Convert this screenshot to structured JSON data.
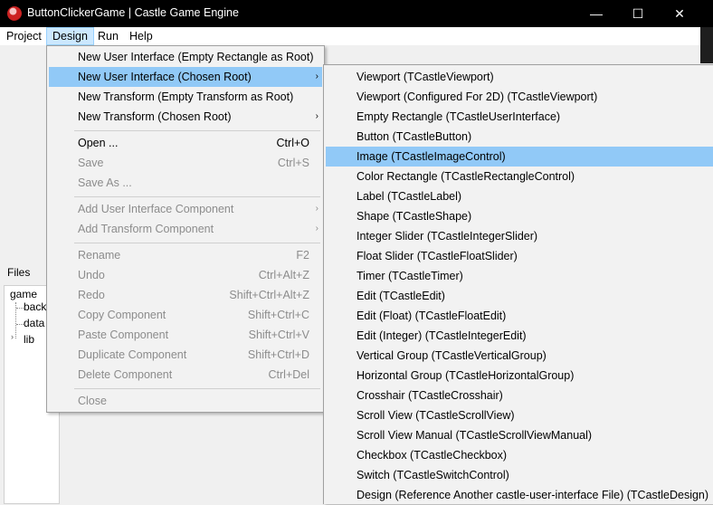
{
  "window": {
    "title": "ButtonClickerGame | Castle Game Engine",
    "minimize": "—",
    "maximize": "☐",
    "close": "✕"
  },
  "menubar": {
    "items": [
      "Project",
      "Design",
      "Run",
      "Help"
    ]
  },
  "files": {
    "tab": "Files",
    "tree": [
      "game",
      "back",
      "data",
      "lib"
    ]
  },
  "design_menu": {
    "items": [
      {
        "label": "New User Interface (Empty Rectangle as Root)",
        "shortcut": "",
        "submenu": ""
      },
      {
        "label": "New User Interface (Chosen Root)",
        "shortcut": "",
        "submenu": "›"
      },
      {
        "label": "New Transform (Empty Transform as Root)",
        "shortcut": "",
        "submenu": ""
      },
      {
        "label": "New Transform (Chosen Root)",
        "shortcut": "",
        "submenu": "›"
      },
      {
        "label": "Open ...",
        "shortcut": "Ctrl+O",
        "submenu": ""
      },
      {
        "label": "Save",
        "shortcut": "Ctrl+S",
        "submenu": ""
      },
      {
        "label": "Save As ...",
        "shortcut": "",
        "submenu": ""
      },
      {
        "label": "Add User Interface Component",
        "shortcut": "",
        "submenu": "›"
      },
      {
        "label": "Add Transform Component",
        "shortcut": "",
        "submenu": "›"
      },
      {
        "label": "Rename",
        "shortcut": "F2",
        "submenu": ""
      },
      {
        "label": "Undo",
        "shortcut": "Ctrl+Alt+Z",
        "submenu": ""
      },
      {
        "label": "Redo",
        "shortcut": "Shift+Ctrl+Alt+Z",
        "submenu": ""
      },
      {
        "label": "Copy Component",
        "shortcut": "Shift+Ctrl+C",
        "submenu": ""
      },
      {
        "label": "Paste Component",
        "shortcut": "Shift+Ctrl+V",
        "submenu": ""
      },
      {
        "label": "Duplicate Component",
        "shortcut": "Shift+Ctrl+D",
        "submenu": ""
      },
      {
        "label": "Delete Component",
        "shortcut": "Ctrl+Del",
        "submenu": ""
      },
      {
        "label": "Close",
        "shortcut": "",
        "submenu": ""
      }
    ]
  },
  "submenu": {
    "items": [
      "Viewport (TCastleViewport)",
      "Viewport (Configured For 2D) (TCastleViewport)",
      "Empty Rectangle (TCastleUserInterface)",
      "Button (TCastleButton)",
      "Image (TCastleImageControl)",
      "Color Rectangle (TCastleRectangleControl)",
      "Label (TCastleLabel)",
      "Shape (TCastleShape)",
      "Integer Slider (TCastleIntegerSlider)",
      "Float Slider (TCastleFloatSlider)",
      "Timer (TCastleTimer)",
      "Edit (TCastleEdit)",
      "Edit (Float) (TCastleFloatEdit)",
      "Edit (Integer) (TCastleIntegerEdit)",
      "Vertical Group (TCastleVerticalGroup)",
      "Horizontal Group (TCastleHorizontalGroup)",
      "Crosshair (TCastleCrosshair)",
      "Scroll View (TCastleScrollView)",
      "Scroll View Manual (TCastleScrollViewManual)",
      "Checkbox (TCastleCheckbox)",
      "Switch (TCastleSwitchControl)",
      "Design (Reference Another castle-user-interface File) (TCastleDesign)"
    ]
  }
}
